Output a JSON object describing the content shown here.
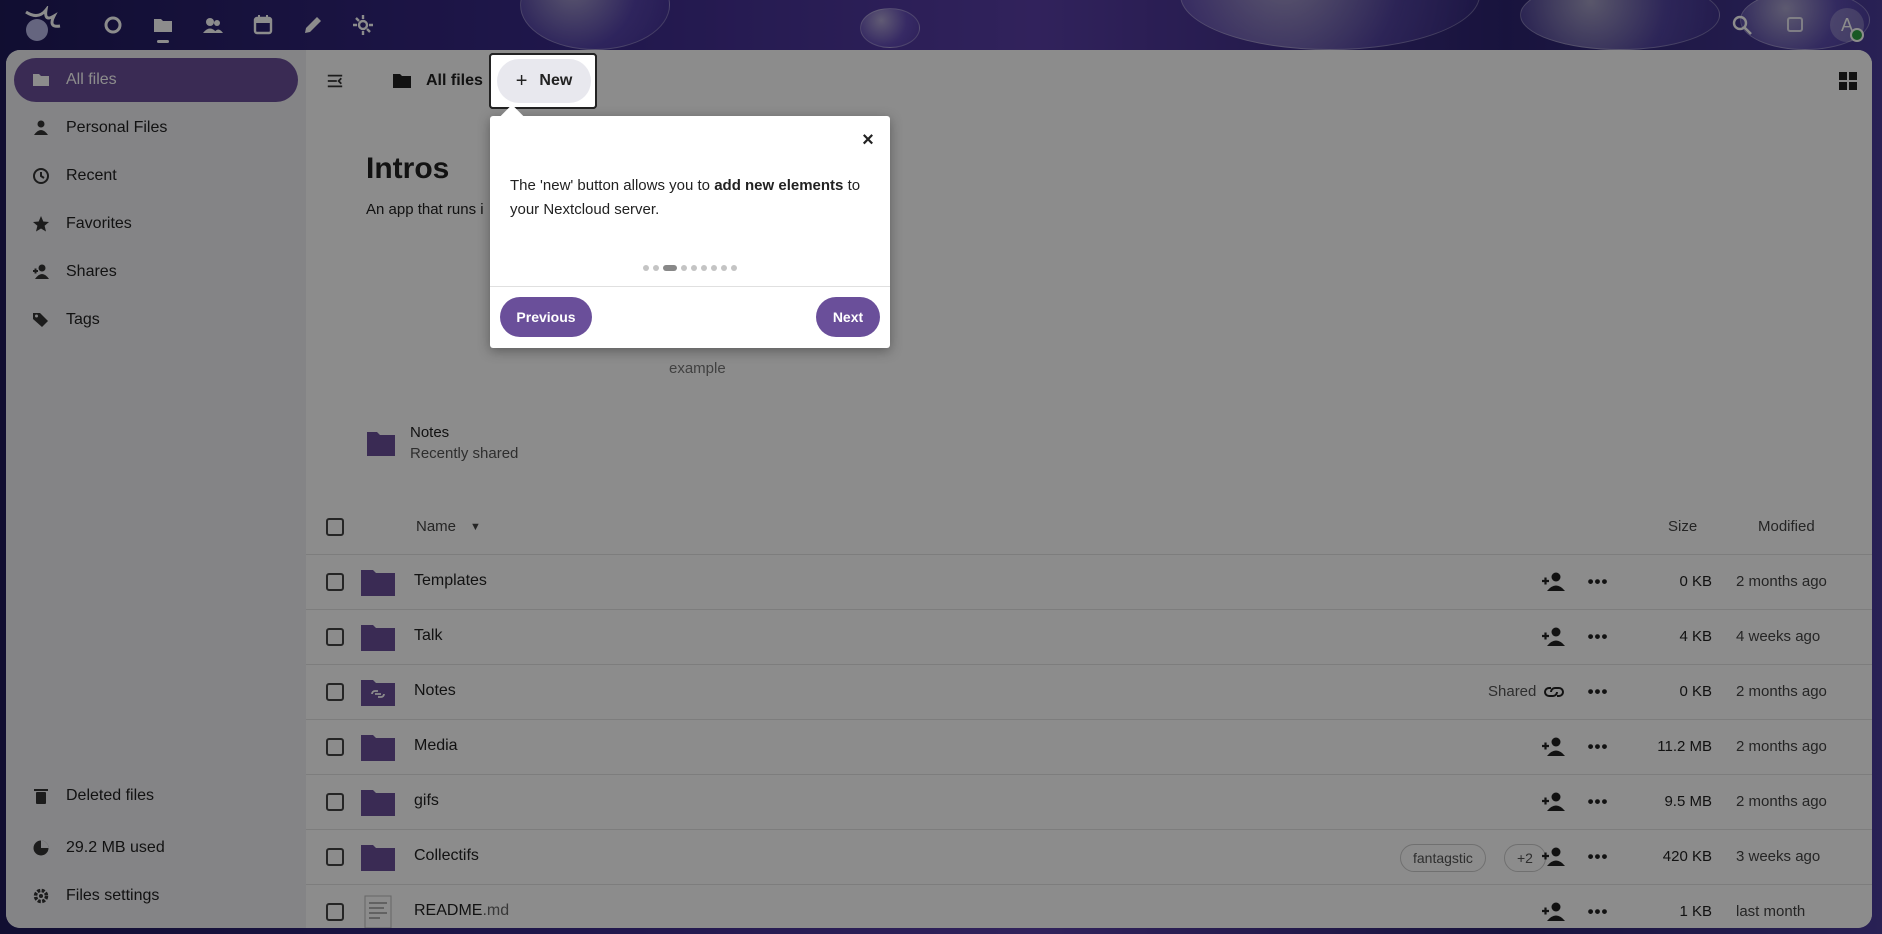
{
  "header": {
    "apps": [
      {
        "icon": "dashboard-icon"
      },
      {
        "icon": "files-icon",
        "active": true
      },
      {
        "icon": "contacts-icon"
      },
      {
        "icon": "calendar-icon"
      },
      {
        "icon": "notes-pencil-icon"
      },
      {
        "icon": "activity-icon"
      }
    ],
    "avatar_letter": "A"
  },
  "sidebar": {
    "items": [
      {
        "label": "All files",
        "icon": "folder-icon",
        "active": true
      },
      {
        "label": "Personal Files",
        "icon": "person-icon"
      },
      {
        "label": "Recent",
        "icon": "history-icon"
      },
      {
        "label": "Favorites",
        "icon": "star-icon"
      },
      {
        "label": "Shares",
        "icon": "share-person-icon"
      },
      {
        "label": "Tags",
        "icon": "tag-icon"
      }
    ],
    "footer": [
      {
        "label": "Deleted files",
        "icon": "trash-icon"
      },
      {
        "label": "29.2 MB used",
        "icon": "pie-chart-icon"
      },
      {
        "label": "Files settings",
        "icon": "gear-icon"
      }
    ]
  },
  "topbar": {
    "breadcrumb": "All files",
    "new_label": "New"
  },
  "intro": {
    "title": "Intros",
    "subtitle": "An app that runs i",
    "example": "example"
  },
  "recent": {
    "name": "Notes",
    "subtitle": "Recently shared"
  },
  "table": {
    "header": {
      "name": "Name",
      "size": "Size",
      "modified": "Modified"
    },
    "rows": [
      {
        "name": "Templates",
        "ext": "",
        "size": "0 KB",
        "modified": "2 months ago",
        "type": "folder"
      },
      {
        "name": "Talk",
        "ext": "",
        "size": "4 KB",
        "modified": "4 weeks ago",
        "type": "folder"
      },
      {
        "name": "Notes",
        "ext": "",
        "size": "0 KB",
        "modified": "2 months ago",
        "type": "folder-link",
        "shared_label": "Shared"
      },
      {
        "name": "Media",
        "ext": "",
        "size": "11.2 MB",
        "modified": "2 months ago",
        "type": "folder"
      },
      {
        "name": "gifs",
        "ext": "",
        "size": "9.5 MB",
        "modified": "2 months ago",
        "type": "folder"
      },
      {
        "name": "Collectifs",
        "ext": "",
        "size": "420 KB",
        "modified": "3 weeks ago",
        "type": "folder",
        "tags": [
          "fantagstic",
          "+2"
        ]
      },
      {
        "name": "README",
        "ext": ".md",
        "size": "1 KB",
        "modified": "last month",
        "type": "file"
      }
    ]
  },
  "tour": {
    "text_before": "The 'new' button allows you to ",
    "text_bold": "add new elements",
    "text_after": " to your Nextcloud server.",
    "dots_total": 9,
    "dot_active": 3,
    "previous_label": "Previous",
    "next_label": "Next",
    "close_glyph": "×"
  },
  "colors": {
    "primary": "#6a4f9a",
    "folder": "#6a4f9a"
  }
}
